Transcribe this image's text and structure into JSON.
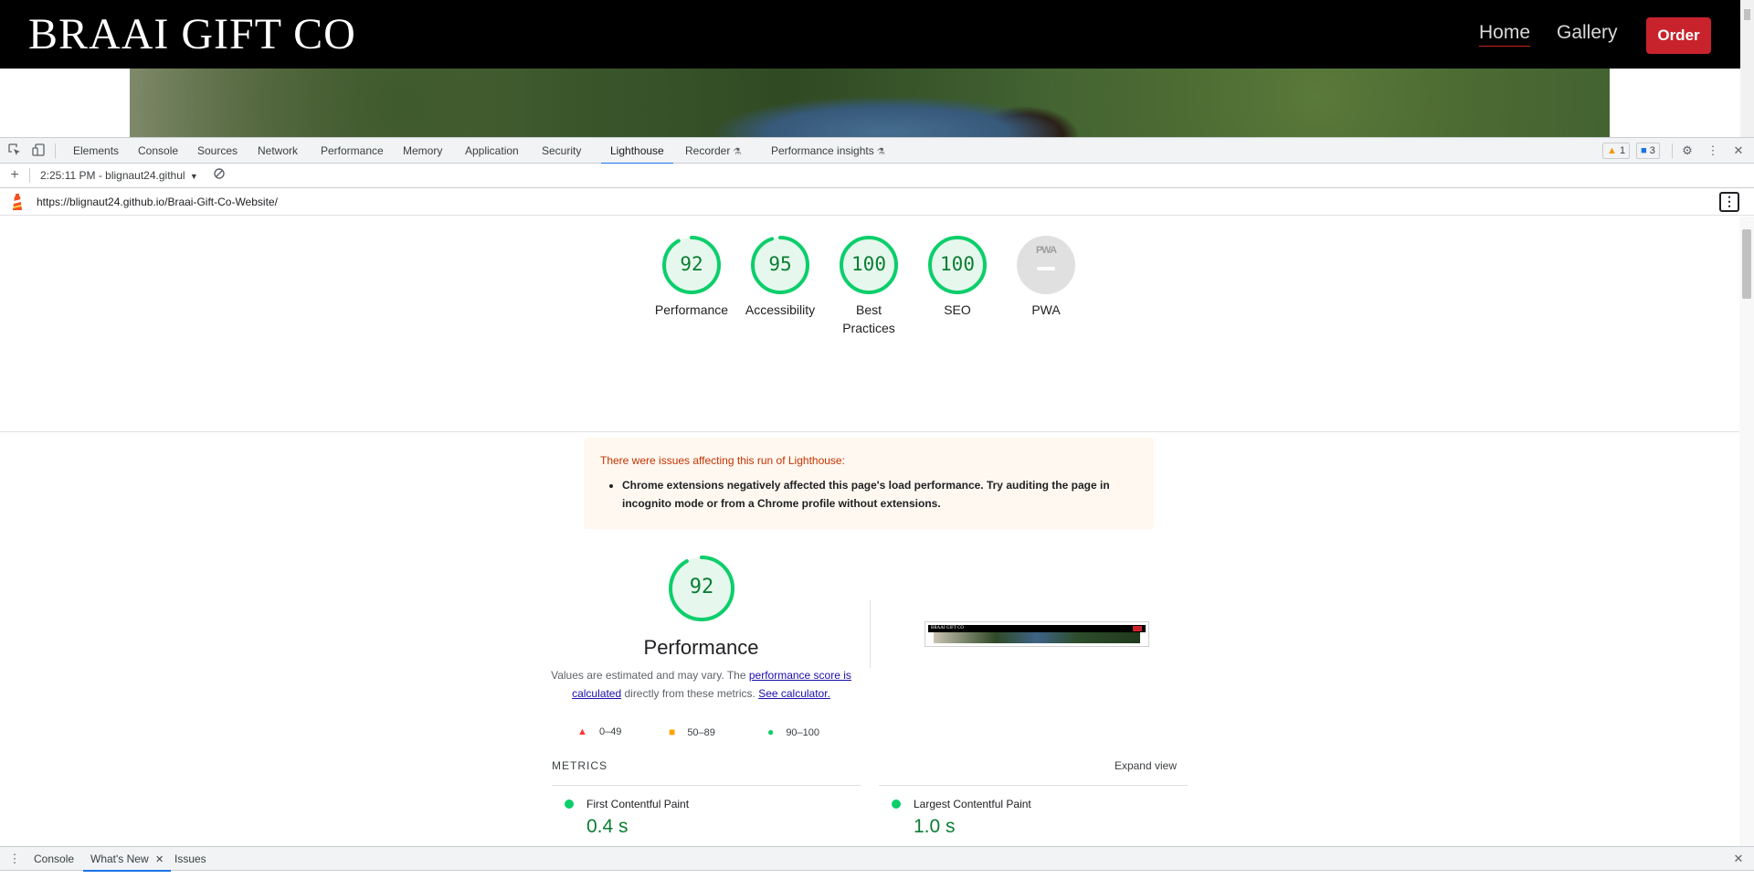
{
  "website": {
    "logo": "BRAAI GIFT CO",
    "nav": {
      "home": "Home",
      "gallery": "Gallery",
      "order": "Order"
    }
  },
  "devtools": {
    "tabs": [
      "Elements",
      "Console",
      "Sources",
      "Network",
      "Performance",
      "Memory",
      "Application",
      "Security",
      "Lighthouse",
      "Recorder",
      "Performance insights"
    ],
    "active_tab": "Lighthouse",
    "warnings_count": "1",
    "messages_count": "3",
    "toolbar": {
      "report_select": "2:25:11 PM - blignaut24.githul"
    },
    "drawer": {
      "tabs": [
        "Console",
        "What's New",
        "Issues"
      ],
      "active": "What's New"
    },
    "colors": {
      "accent": "#1a73e8",
      "pass": "#0cce6b",
      "pass_text": "#0c7d33"
    }
  },
  "lighthouse": {
    "url": "https://blignaut24.github.io/Braai-Gift-Co-Website/",
    "categories": [
      {
        "label": "Performance",
        "score": "92"
      },
      {
        "label": "Accessibility",
        "score": "95"
      },
      {
        "label": "Best Practices",
        "score": "100"
      },
      {
        "label": "SEO",
        "score": "100"
      },
      {
        "label": "PWA",
        "score": "PWA"
      }
    ],
    "warning": {
      "title": "There were issues affecting this run of Lighthouse:",
      "item": "Chrome extensions negatively affected this page's load performance. Try auditing the page in incognito mode or from a Chrome profile without extensions."
    },
    "performance": {
      "score": "92",
      "title": "Performance",
      "desc_1": "Values are estimated and may vary. The ",
      "desc_link_1": "performance score is calculated",
      "desc_2": " directly from these metrics. ",
      "desc_link_2": "See calculator.",
      "legend": [
        "0–49",
        "50–89",
        "90–100"
      ]
    },
    "metrics": {
      "title": "METRICS",
      "expand": "Expand view",
      "items": [
        {
          "name": "First Contentful Paint",
          "value": "0.4 s"
        },
        {
          "name": "Largest Contentful Paint",
          "value": "1.0 s"
        }
      ]
    }
  }
}
